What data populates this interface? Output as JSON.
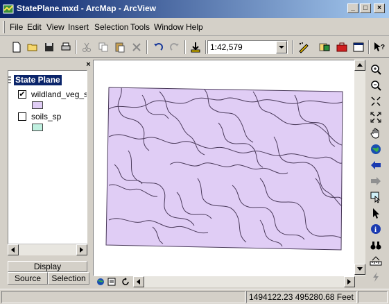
{
  "window": {
    "title": "StatePlane.mxd - ArcMap - ArcView",
    "min_label": "_",
    "max_label": "□",
    "close_label": "×"
  },
  "menu": {
    "items": [
      "File",
      "Edit",
      "View",
      "Insert",
      "Selection",
      "Tools",
      "Window",
      "Help"
    ]
  },
  "toolbar": {
    "scale_value": "1:42,579",
    "icons": [
      "new-document-icon",
      "open-folder-icon",
      "save-icon",
      "print-icon",
      "cut-icon",
      "copy-icon",
      "paste-icon",
      "delete-icon",
      "undo-icon",
      "redo-icon",
      "add-data-icon",
      "editor-icon",
      "arccatalog-icon",
      "arctoolbox-icon",
      "command-line-icon",
      "whats-this-icon"
    ]
  },
  "toc": {
    "data_frame": "State Plane",
    "close_label": "×",
    "layers": [
      {
        "name": "wildland_veg_sp",
        "checked": true,
        "checkmark": "✔",
        "color": "#e0cdf5"
      },
      {
        "name": "soils_sp",
        "checked": false,
        "checkmark": "",
        "color": "#c0f0e0"
      }
    ],
    "tabs": {
      "display": "Display",
      "source": "Source",
      "selection": "Selection"
    }
  },
  "map": {
    "polygon_fill": "#e0cdf5",
    "line_color": "#4a3a5a"
  },
  "tools_panel": {
    "icons": [
      "zoom-in-icon",
      "zoom-out-icon",
      "fixed-zoom-in-icon",
      "fixed-zoom-out-icon",
      "pan-icon",
      "full-extent-icon",
      "back-extent-icon",
      "forward-extent-icon",
      "select-features-icon",
      "select-elements-icon",
      "identify-icon",
      "find-icon",
      "measure-icon",
      "hyperlink-icon"
    ]
  },
  "status": {
    "coordinates": "1494122.23  495280.68 Feet"
  },
  "colors": {
    "titlebar_start": "#0a246a",
    "titlebar_end": "#a6caf0",
    "chrome": "#d4d0c8",
    "selection_highlight": "#0a246a"
  }
}
